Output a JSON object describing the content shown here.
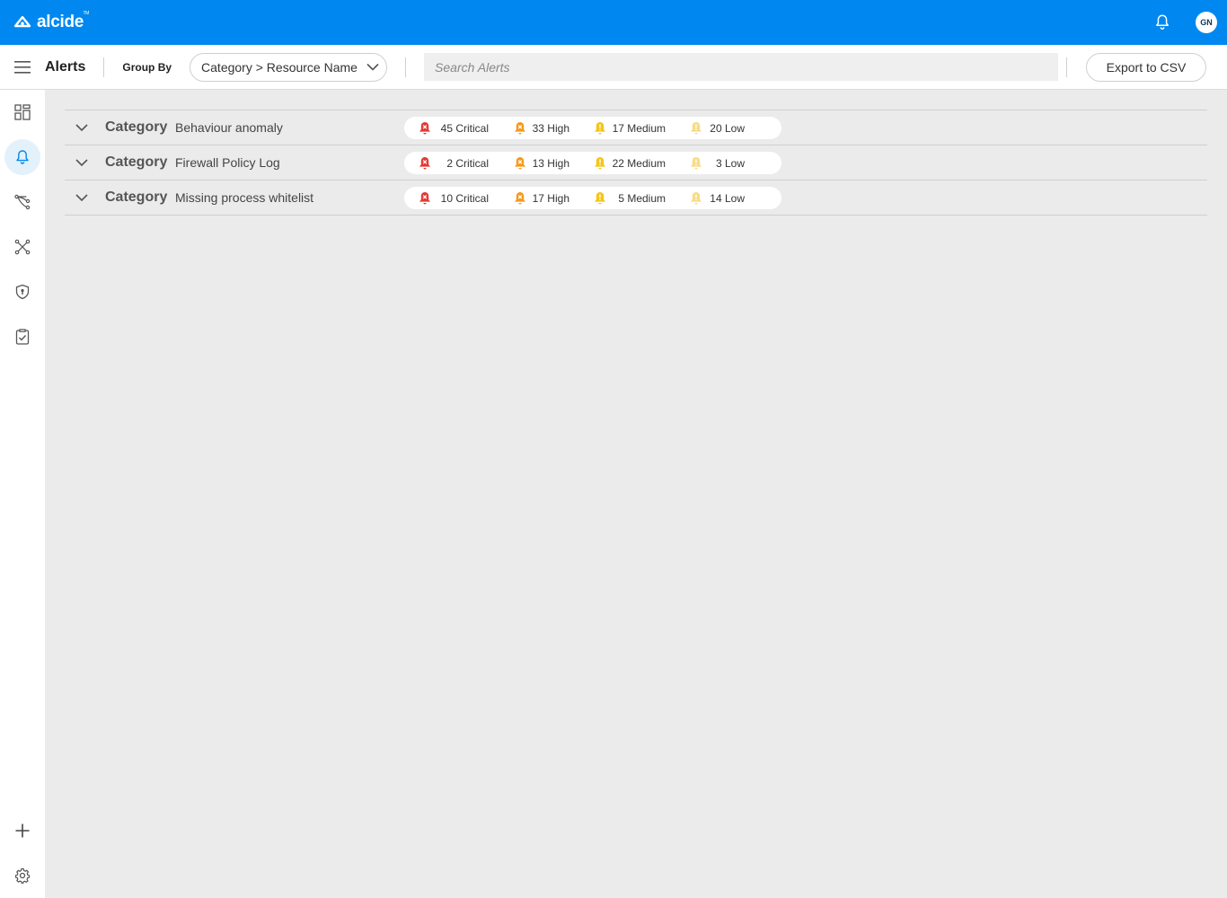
{
  "header": {
    "logo_text": "alcide",
    "logo_tm": "TM",
    "avatar_initials": "GN"
  },
  "toolbar": {
    "title": "Alerts",
    "group_by_label": "Group By",
    "group_by_value": "Category > Resource Name",
    "search_placeholder": "Search Alerts",
    "export_label": "Export to CSV"
  },
  "sidebar": {
    "items": [
      {
        "icon": "dashboard-icon",
        "active": false
      },
      {
        "icon": "bell-icon",
        "active": true
      },
      {
        "icon": "flow-icon",
        "active": false
      },
      {
        "icon": "network-icon",
        "active": false
      },
      {
        "icon": "shield-icon",
        "active": false
      },
      {
        "icon": "checklist-icon",
        "active": false
      }
    ],
    "bottom": [
      {
        "icon": "plus-icon"
      },
      {
        "icon": "gear-icon"
      }
    ]
  },
  "colors": {
    "brand": "#0088f0",
    "critical": "#e53935",
    "high": "#f59a1b",
    "medium": "#f5c518",
    "low": "#f7dc85"
  },
  "groups": [
    {
      "key": "Category",
      "value": "Behaviour anomaly",
      "critical": "45 Critical",
      "high": "33 High",
      "medium": "17 Medium",
      "low": "20 Low"
    },
    {
      "key": "Category",
      "value": "Firewall Policy Log",
      "critical": "2 Critical",
      "high": "13 High",
      "medium": "22 Medium",
      "low": "3 Low"
    },
    {
      "key": "Category",
      "value": "Missing process whitelist",
      "critical": "10 Critical",
      "high": "17 High",
      "medium": "5 Medium",
      "low": "14 Low"
    }
  ]
}
